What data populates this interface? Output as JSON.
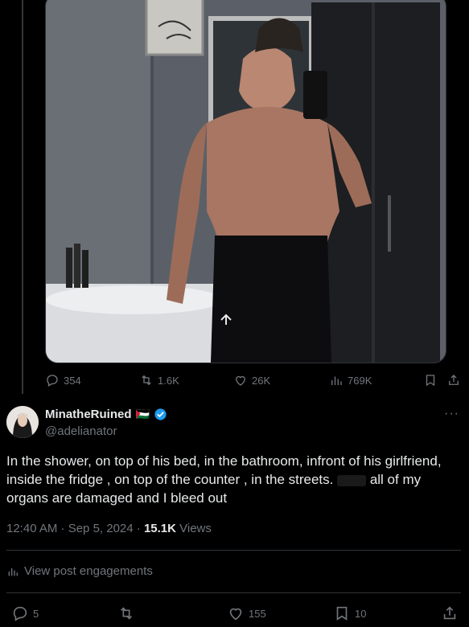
{
  "media_actions": {
    "replies": "354",
    "reposts": "1.6K",
    "likes": "26K",
    "views": "769K"
  },
  "reply_tweet": {
    "display_name": "MinatheRuined",
    "flag": "🇵🇸",
    "handle": "@adelianator",
    "text": "In the shower,  on top of his bed, in the bathroom, infront of his girlfriend, inside the fridge , on top of the counter , in the streets.",
    "text_tail": " all of my organs are damaged and I bleed out",
    "time": "12:40 AM · Sep 5, 2024 · ",
    "view_count": "15.1K",
    "views_label": " Views",
    "engagements_label": "View post engagements",
    "actions": {
      "replies": "5",
      "likes": "155",
      "bookmarks": "10"
    }
  },
  "colors": {
    "background": "#000000",
    "muted": "#71767b",
    "text": "#e7e9ea",
    "verified": "#1d9bf0"
  }
}
